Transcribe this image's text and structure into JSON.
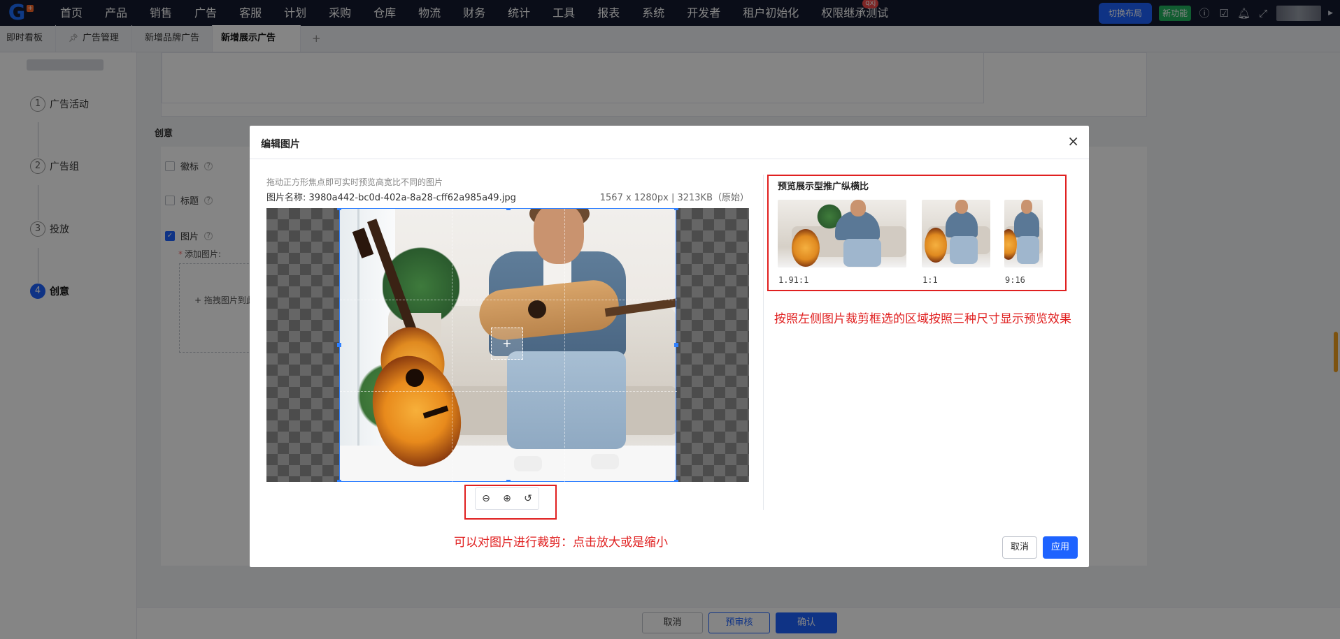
{
  "topnav": {
    "logo_text": "G",
    "menu": [
      "首页",
      "产品",
      "销售",
      "广告",
      "客服",
      "计划",
      "采购",
      "仓库",
      "物流",
      "财务",
      "统计",
      "工具",
      "报表",
      "系统",
      "开发者",
      "租户初始化",
      "权限继承测试"
    ],
    "badge_text": "qxj",
    "switch_layout": "切换布局",
    "new_feature": "新功能"
  },
  "tabs": {
    "items": [
      "即时看板",
      "广告管理",
      "新增品牌广告",
      "新增展示广告"
    ],
    "active_index": 3,
    "pinned_index": 1,
    "add": "+"
  },
  "steps": {
    "items": [
      {
        "num": "1",
        "label": "广告活动"
      },
      {
        "num": "2",
        "label": "广告组"
      },
      {
        "num": "3",
        "label": "投放"
      },
      {
        "num": "4",
        "label": "创意"
      }
    ],
    "active_index": 3
  },
  "form": {
    "section_title": "创意",
    "checkbox_logo": "徽标",
    "checkbox_title": "标题",
    "checkbox_image": "图片",
    "add_image_label": "添加图片:",
    "upload_text": "+ 拖拽图片到此"
  },
  "bottom_bar": {
    "cancel": "取消",
    "pre_review": "预审核",
    "confirm": "确认"
  },
  "modal": {
    "title": "编辑图片",
    "close": "×",
    "hint": "拖动正方形焦点即可实时预览高宽比不同的图片",
    "filename_label": "图片名称:",
    "filename": "3980a442-bc0d-402a-8a28-cff62a985a49.jpg",
    "file_meta": "1567 x 1280px | 3213KB（原始）",
    "zoom_out": "⊖",
    "zoom_in": "⊕",
    "reset": "↺",
    "crop_note": "可以对图片进行裁剪：点击放大或是缩小",
    "preview_title": "预览展示型推广纵横比",
    "previews": [
      {
        "label": "1.91:1"
      },
      {
        "label": "1:1"
      },
      {
        "label": "9:16"
      }
    ],
    "preview_note": "按照左侧图片裁剪框选的区域按照三种尺寸显示预览效果",
    "cancel": "取消",
    "apply": "应用"
  },
  "colors": {
    "primary": "#1e63ff",
    "annotation_red": "#e02020",
    "nav_bg": "#141a2e",
    "new_feature_green": "#22b35e"
  }
}
